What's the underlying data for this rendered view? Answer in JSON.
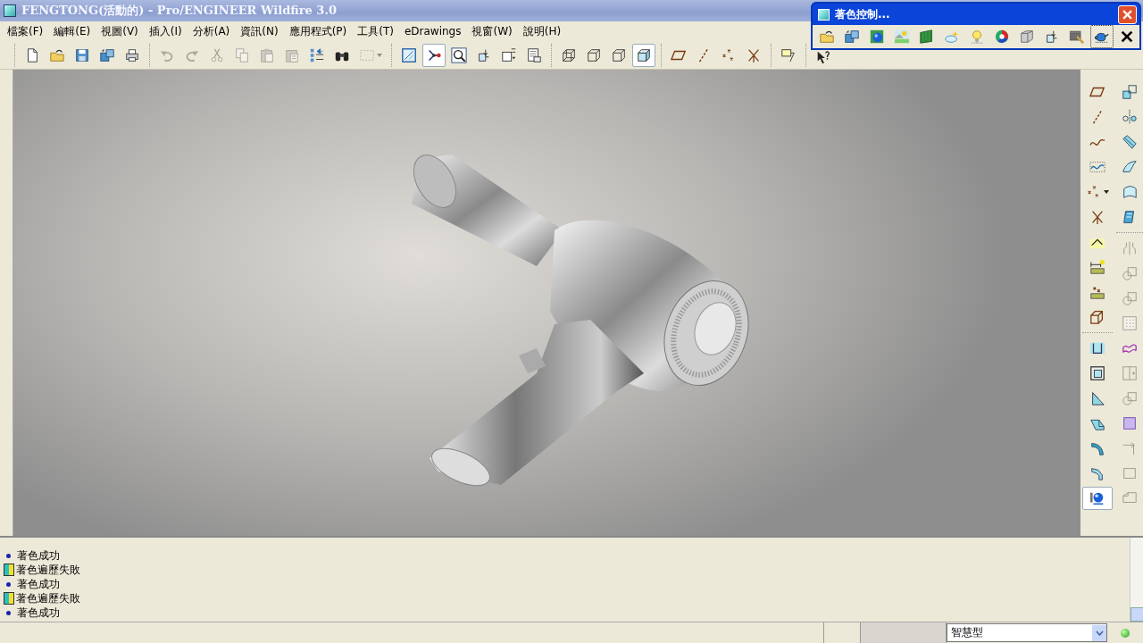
{
  "window": {
    "title": "FENGTONG(活動的) - Pro/ENGINEER Wildfire 3.0"
  },
  "menu": [
    "檔案(F)",
    "編輯(E)",
    "視圖(V)",
    "插入(I)",
    "分析(A)",
    "資訊(N)",
    "應用程式(P)",
    "工具(T)",
    "eDrawings",
    "視窗(W)",
    "說明(H)"
  ],
  "toolbar": {
    "groups": [
      {
        "items": [
          {
            "kind": "page",
            "disabled": false,
            "selected": false
          },
          {
            "kind": "folder",
            "disabled": false,
            "selected": false
          },
          {
            "kind": "floppy",
            "disabled": false,
            "selected": false
          },
          {
            "kind": "floppies",
            "disabled": false,
            "selected": false
          },
          {
            "kind": "printer",
            "disabled": false,
            "selected": false
          }
        ]
      },
      {
        "items": [
          {
            "kind": "undo",
            "disabled": true,
            "selected": false
          },
          {
            "kind": "redo",
            "disabled": true,
            "selected": false
          },
          {
            "kind": "scissors",
            "disabled": true,
            "selected": false
          },
          {
            "kind": "copy",
            "disabled": true,
            "selected": false
          },
          {
            "kind": "clipboard",
            "disabled": true,
            "selected": false
          },
          {
            "kind": "clipboardlist",
            "disabled": true,
            "selected": false
          },
          {
            "kind": "regen",
            "disabled": false,
            "selected": false
          },
          {
            "kind": "binoculars",
            "disabled": false,
            "selected": false
          },
          {
            "kind": "dotbox",
            "disabled": true,
            "selected": false,
            "dropdown": true
          }
        ]
      },
      {
        "items": [
          {
            "kind": "repaint",
            "disabled": false,
            "selected": false
          },
          {
            "kind": "nodes",
            "disabled": false,
            "selected": true
          },
          {
            "kind": "magnifier",
            "disabled": false,
            "selected": false
          },
          {
            "kind": "cubearrow",
            "disabled": false,
            "selected": false
          },
          {
            "kind": "boxab",
            "disabled": false,
            "selected": false
          },
          {
            "kind": "layers",
            "disabled": false,
            "selected": false
          }
        ]
      },
      {
        "items": [
          {
            "kind": "wire",
            "disabled": false,
            "selected": false
          },
          {
            "kind": "hidden",
            "disabled": false,
            "selected": false
          },
          {
            "kind": "hidden",
            "disabled": false,
            "selected": false
          },
          {
            "kind": "shaded",
            "disabled": false,
            "selected": true
          }
        ]
      },
      {
        "items": [
          {
            "kind": "plane",
            "disabled": false,
            "selected": false
          },
          {
            "kind": "axis",
            "disabled": false,
            "selected": false
          },
          {
            "kind": "points",
            "disabled": false,
            "selected": false
          },
          {
            "kind": "csys",
            "disabled": false,
            "selected": false
          }
        ]
      },
      {
        "items": [
          {
            "kind": "note",
            "disabled": false,
            "selected": false
          }
        ]
      },
      {
        "items": [
          {
            "kind": "help",
            "disabled": false,
            "selected": false
          }
        ]
      }
    ]
  },
  "shade_window": {
    "title": "著色控制...",
    "items": [
      {
        "kind": "folder",
        "selected": false
      },
      {
        "kind": "floppies",
        "selected": false
      },
      {
        "kind": "spheremap",
        "selected": false
      },
      {
        "kind": "landscape",
        "selected": false
      },
      {
        "kind": "greensquare",
        "selected": false
      },
      {
        "kind": "cloud",
        "selected": false
      },
      {
        "kind": "bulb",
        "selected": false
      },
      {
        "kind": "wheel",
        "selected": false
      },
      {
        "kind": "graybox",
        "selected": false
      },
      {
        "kind": "cubearrow",
        "selected": false
      },
      {
        "kind": "brush",
        "selected": false
      },
      {
        "kind": "teapot",
        "selected": true
      },
      {
        "kind": "xmark",
        "selected": false
      }
    ]
  },
  "side_toolbar": {
    "columns": [
      {
        "groups": [
          [
            {
              "kind": "plane",
              "disabled": false,
              "selected": false
            },
            {
              "kind": "axis",
              "disabled": false,
              "selected": false
            },
            {
              "kind": "curve",
              "disabled": false,
              "selected": false
            },
            {
              "kind": "dottedwave",
              "disabled": false,
              "selected": false
            },
            {
              "kind": "points",
              "disabled": false,
              "selected": false,
              "dropdown": true
            },
            {
              "kind": "csys",
              "disabled": false,
              "selected": false
            },
            {
              "kind": "angle",
              "disabled": false,
              "selected": false
            },
            {
              "kind": "ruler",
              "disabled": false,
              "selected": false
            },
            {
              "kind": "pointgrid",
              "disabled": false,
              "selected": false
            },
            {
              "kind": "stacked",
              "disabled": false,
              "selected": false
            }
          ],
          [
            {
              "kind": "channel",
              "disabled": false,
              "selected": false
            },
            {
              "kind": "frame",
              "disabled": false,
              "selected": false
            },
            {
              "kind": "triangle",
              "disabled": false,
              "selected": false
            },
            {
              "kind": "block",
              "disabled": false,
              "selected": false
            },
            {
              "kind": "arc",
              "disabled": false,
              "selected": false
            },
            {
              "kind": "bent",
              "disabled": false,
              "selected": false
            },
            {
              "kind": "sphere",
              "disabled": false,
              "selected": true
            }
          ]
        ]
      },
      {
        "groups": [
          [
            {
              "kind": "boxarrow",
              "disabled": false,
              "selected": false
            },
            {
              "kind": "mirror",
              "disabled": false,
              "selected": false
            },
            {
              "kind": "sweep",
              "disabled": false,
              "selected": false
            },
            {
              "kind": "sheet",
              "disabled": false,
              "selected": false
            },
            {
              "kind": "patch",
              "disabled": false,
              "selected": false
            },
            {
              "kind": "scroll",
              "disabled": false,
              "selected": false
            }
          ],
          [
            {
              "kind": "brackets",
              "disabled": true,
              "selected": false
            },
            {
              "kind": "circlesquare",
              "disabled": true,
              "selected": false
            },
            {
              "kind": "circlesquare",
              "disabled": true,
              "selected": false
            },
            {
              "kind": "dotgrid",
              "disabled": true,
              "selected": false
            },
            {
              "kind": "purplewave",
              "disabled": false,
              "selected": false
            },
            {
              "kind": "boxplus",
              "disabled": true,
              "selected": false
            },
            {
              "kind": "circlesquare",
              "disabled": true,
              "selected": false
            },
            {
              "kind": "purplesquare",
              "disabled": false,
              "selected": false
            },
            {
              "kind": "cornerarrow",
              "disabled": true,
              "selected": false
            },
            {
              "kind": "plainsquare",
              "disabled": true,
              "selected": false
            },
            {
              "kind": "sheetcorner",
              "disabled": true,
              "selected": false
            }
          ]
        ]
      }
    ]
  },
  "messages": [
    {
      "kind": "info",
      "text": "著色成功"
    },
    {
      "kind": "warning",
      "text": "著色遍歷失敗"
    },
    {
      "kind": "info",
      "text": "著色成功"
    },
    {
      "kind": "warning",
      "text": "著色遍歷失敗"
    },
    {
      "kind": "info",
      "text": "著色成功"
    }
  ],
  "status_bar": {
    "filter": {
      "value": "智慧型"
    }
  }
}
